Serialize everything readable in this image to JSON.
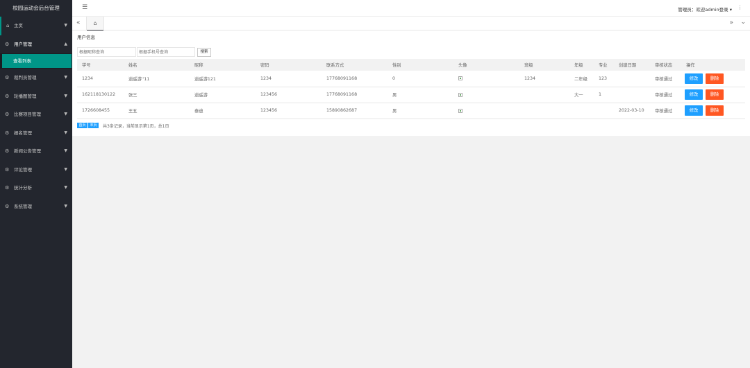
{
  "sidebar": {
    "logo": "校园运动会后台管理",
    "items": [
      {
        "label": "主页",
        "icon": "home-icon"
      },
      {
        "label": "用户管理",
        "icon": "gear-icon"
      },
      {
        "label": "裁判员管理",
        "icon": "gear-icon"
      },
      {
        "label": "轮播图管理",
        "icon": "gear-icon"
      },
      {
        "label": "比赛项目管理",
        "icon": "gear-icon"
      },
      {
        "label": "报名管理",
        "icon": "gear-icon"
      },
      {
        "label": "新闻公告管理",
        "icon": "gear-icon"
      },
      {
        "label": "评论管理",
        "icon": "gear-icon"
      },
      {
        "label": "统计分析",
        "icon": "gear-icon"
      },
      {
        "label": "系统管理",
        "icon": "gear-icon"
      }
    ],
    "sub_item": "查看列表"
  },
  "header": {
    "admin_label": "管理员：欢迎admin登录 ▾"
  },
  "card": {
    "title": "用户信息",
    "name_placeholder": "根据昵称查询",
    "phone_placeholder": "根据手机号查询",
    "search_label": "搜索"
  },
  "table": {
    "headers": [
      "学号",
      "姓名",
      "昵称",
      "密码",
      "联系方式",
      "性别",
      "头像",
      "班级",
      "年级",
      "专业",
      "创建日期",
      "审核状态",
      "操作"
    ],
    "rows": [
      {
        "student_id": "1234",
        "name": "逍遥游''11",
        "nickname": "逍遥游121",
        "password": "1234",
        "phone": "17768091168",
        "gender": "0",
        "class": "1234",
        "grade": "二年级",
        "major": "123",
        "created": "",
        "status": "审核通过"
      },
      {
        "student_id": "162118130122",
        "name": "张三",
        "nickname": "逍遥游",
        "password": "123456",
        "phone": "17768091168",
        "gender": "男",
        "class": "",
        "grade": "大一",
        "major": "1",
        "created": "",
        "status": "审核通过"
      },
      {
        "student_id": "1726608455",
        "name": "王五",
        "nickname": "泰迪",
        "password": "123456",
        "phone": "15890862687",
        "gender": "男",
        "class": "",
        "grade": "",
        "major": "",
        "created": "2022-03-10",
        "status": "审核通过"
      }
    ],
    "edit_label": "修改",
    "delete_label": "删除"
  },
  "pager": {
    "first": "首页",
    "last": "末页",
    "info": "共3条记录，当前显示第1页，总1页"
  },
  "colors": {
    "sidebar_bg": "#23262e",
    "accent": "#009688",
    "edit_btn": "#1e9fff",
    "delete_btn": "#ff5722"
  }
}
